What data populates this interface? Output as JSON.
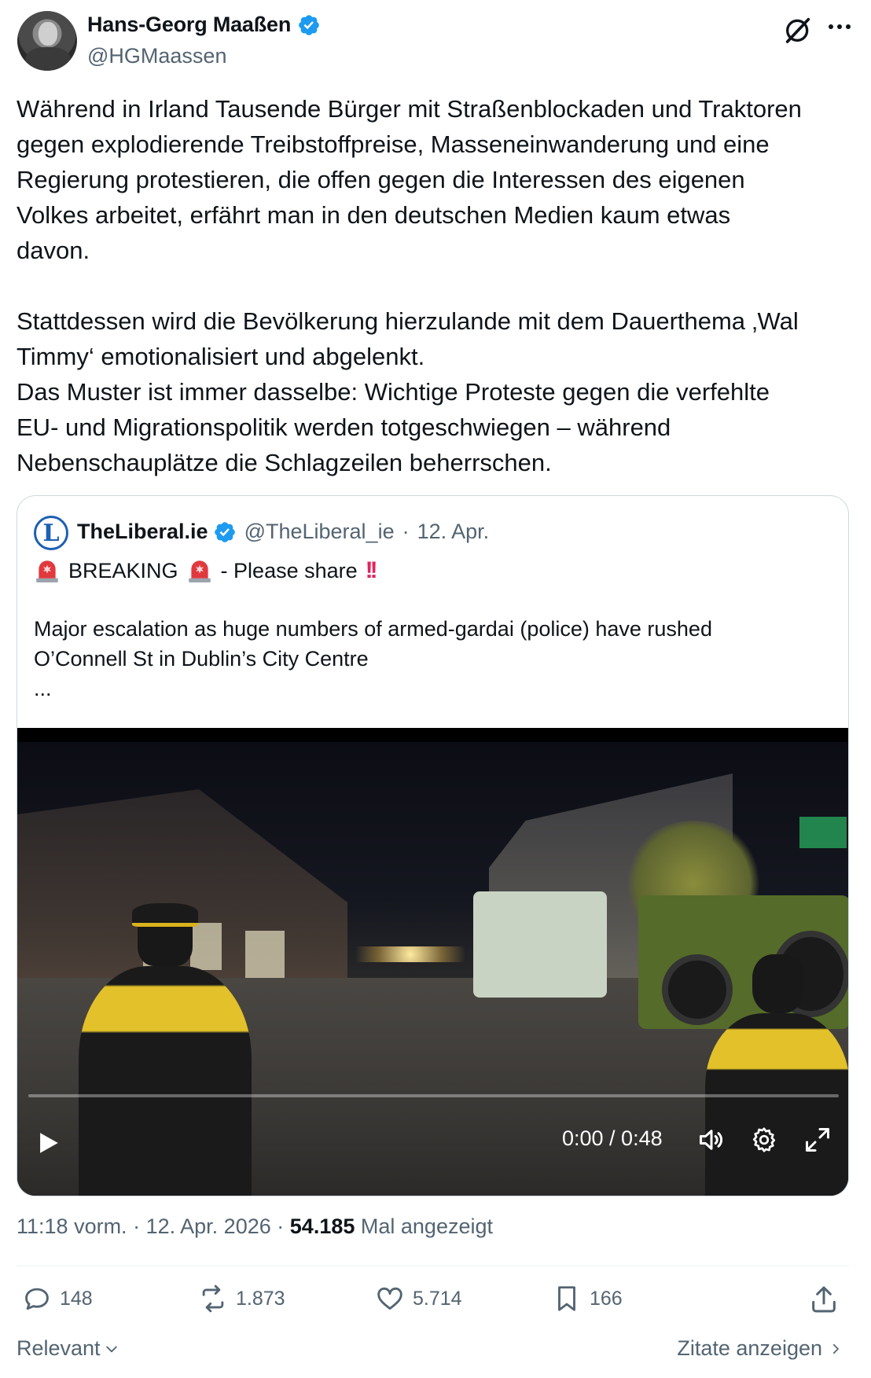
{
  "author": {
    "display_name": "Hans-Georg Maaßen",
    "handle": "@HGMaassen"
  },
  "tweet": {
    "paragraph1": "Während in Irland Tausende Bürger mit Straßenblockaden und Traktoren\ngegen explodierende Treibstoffpreise, Masseneinwanderung und eine\nRegierung protestieren, die offen gegen die Interessen des eigenen\nVolkes arbeitet, erfährt man in den deutschen Medien kaum etwas\ndavon.",
    "paragraph2": "Stattdessen wird die Bevölkerung hierzulande mit dem Dauerthema ‚Wal\nTimmy‘ emotionalisiert und abgelenkt.\nDas Muster ist immer dasselbe: Wichtige Proteste gegen die verfehlte\nEU- und Migrationspolitik werden totgeschwiegen – während\nNebenschauplätze die Schlagzeilen beherrschen."
  },
  "quote": {
    "avatar_letter": "L",
    "display_name": "TheLiberal.ie",
    "handle": "@TheLiberal_ie",
    "separator": "·",
    "date": "12. Apr.",
    "breaking": "BREAKING",
    "please_share": "- Please share",
    "exclamation": "!!",
    "text": "Major escalation as huge numbers of armed-gardai (police) have rushed\nO’Connell St in Dublin’s City Centre",
    "ellipsis": "...",
    "video": {
      "time": "0:00 / 0:48",
      "progress": 0
    }
  },
  "meta": {
    "time": "11:18 vorm.",
    "sep1": "·",
    "date": "12. Apr. 2026",
    "sep2": "·",
    "views": "54.185",
    "views_label": "Mal angezeigt"
  },
  "actions": {
    "replies": "148",
    "reposts": "1.873",
    "likes": "5.714",
    "bookmarks": "166"
  },
  "footer": {
    "sort_label": "Relevant",
    "quotes_link": "Zitate anzeigen"
  },
  "colors": {
    "verified_blue": "#1d9bf0",
    "secondary_text": "#536471",
    "primary_text": "#0f1419",
    "border": "#cfd9de"
  }
}
